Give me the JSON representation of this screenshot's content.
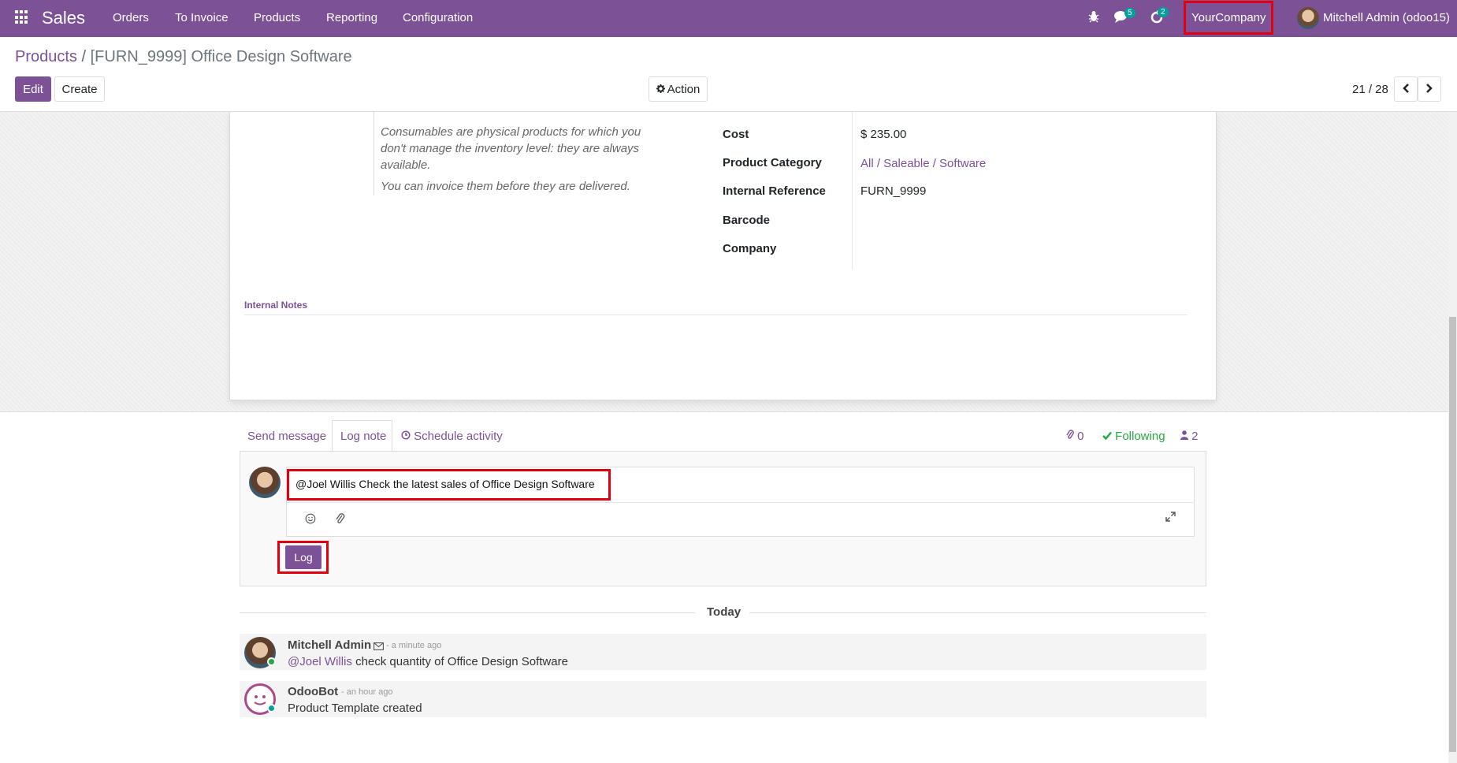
{
  "navbar": {
    "app_name": "Sales",
    "menus": [
      "Orders",
      "To Invoice",
      "Products",
      "Reporting",
      "Configuration"
    ],
    "messages_count": "5",
    "activities_count": "2",
    "company": "YourCompany",
    "user": "Mitchell Admin (odoo15)"
  },
  "breadcrumb": {
    "parent": "Products",
    "separator": "/",
    "current": "[FURN_9999] Office Design Software"
  },
  "toolbar": {
    "edit_label": "Edit",
    "create_label": "Create",
    "action_label": "Action",
    "pager": "21 / 28"
  },
  "form": {
    "help_text_1": "Consumables are physical products for which you don't manage the inventory level: they are always available.",
    "help_text_2": "You can invoice them before they are delivered.",
    "fields": [
      {
        "label": "Cost",
        "value": "$ 235.00"
      },
      {
        "label": "Product Category",
        "value": "All / Saleable / Software"
      },
      {
        "label": "Internal Reference",
        "value": "FURN_9999"
      },
      {
        "label": "Barcode",
        "value": ""
      },
      {
        "label": "Company",
        "value": ""
      }
    ],
    "internal_notes_label": "Internal Notes"
  },
  "chatter": {
    "tabs": {
      "send_message": "Send message",
      "log_note": "Log note",
      "schedule_activity": "Schedule activity"
    },
    "attachments_count": "0",
    "following_label": "Following",
    "followers_count": "2",
    "composer_text": "@Joel Willis Check the latest sales of Office Design Software",
    "log_button": "Log",
    "today_label": "Today",
    "messages": [
      {
        "author": "Mitchell Admin",
        "date": "- a minute ago",
        "mention": "@Joel Willis",
        "body": "check quantity of Office Design Software"
      },
      {
        "author": "OdooBot",
        "date": "- an hour ago",
        "mention": "",
        "body": "Product Template created"
      }
    ]
  },
  "colors": {
    "brand": "#7c5196",
    "highlight": "#e00010",
    "following": "#28a745"
  }
}
